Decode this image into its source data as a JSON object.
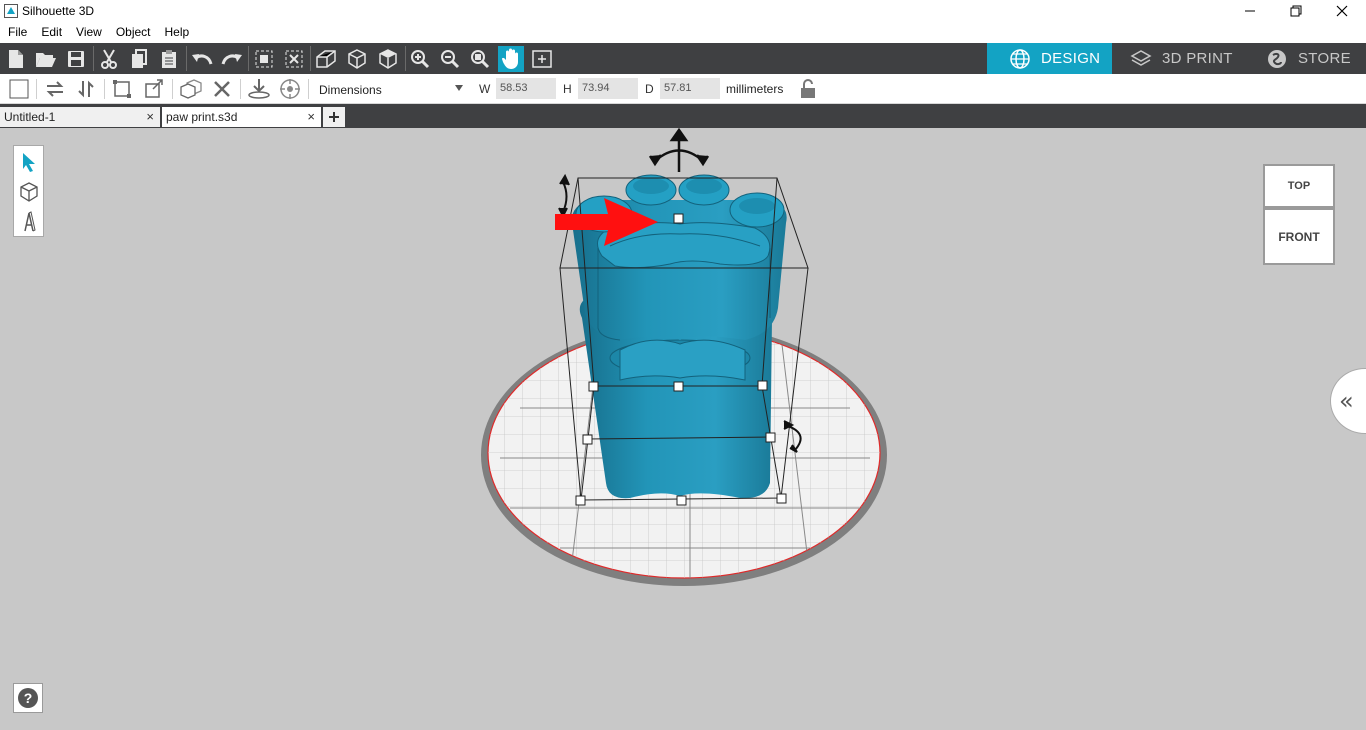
{
  "app": {
    "title": "Silhouette 3D"
  },
  "menu": [
    "File",
    "Edit",
    "View",
    "Object",
    "Help"
  ],
  "modes": [
    {
      "label": "DESIGN",
      "icon": "globe-icon",
      "active": true
    },
    {
      "label": "3D PRINT",
      "icon": "layers-icon",
      "active": false
    },
    {
      "label": "STORE",
      "icon": "store-icon",
      "active": false
    }
  ],
  "toolbar": {
    "dropdown_value": "Dimensions",
    "w_label": "W",
    "w_value": "58.53",
    "h_label": "H",
    "h_value": "73.94",
    "d_label": "D",
    "d_value": "57.81",
    "units": "millimeters"
  },
  "tabs": [
    {
      "label": "Untitled-1",
      "active": false
    },
    {
      "label": "paw print.s3d",
      "active": true
    }
  ],
  "viewcube": {
    "top": "TOP",
    "front": "FRONT"
  },
  "help": {
    "label": "?"
  },
  "colors": {
    "accent": "#13a3c4",
    "model": "#1e8fb3",
    "toolbar": "#3f4042",
    "viewport": "#c8c8c8",
    "arrow": "#ff1010"
  }
}
